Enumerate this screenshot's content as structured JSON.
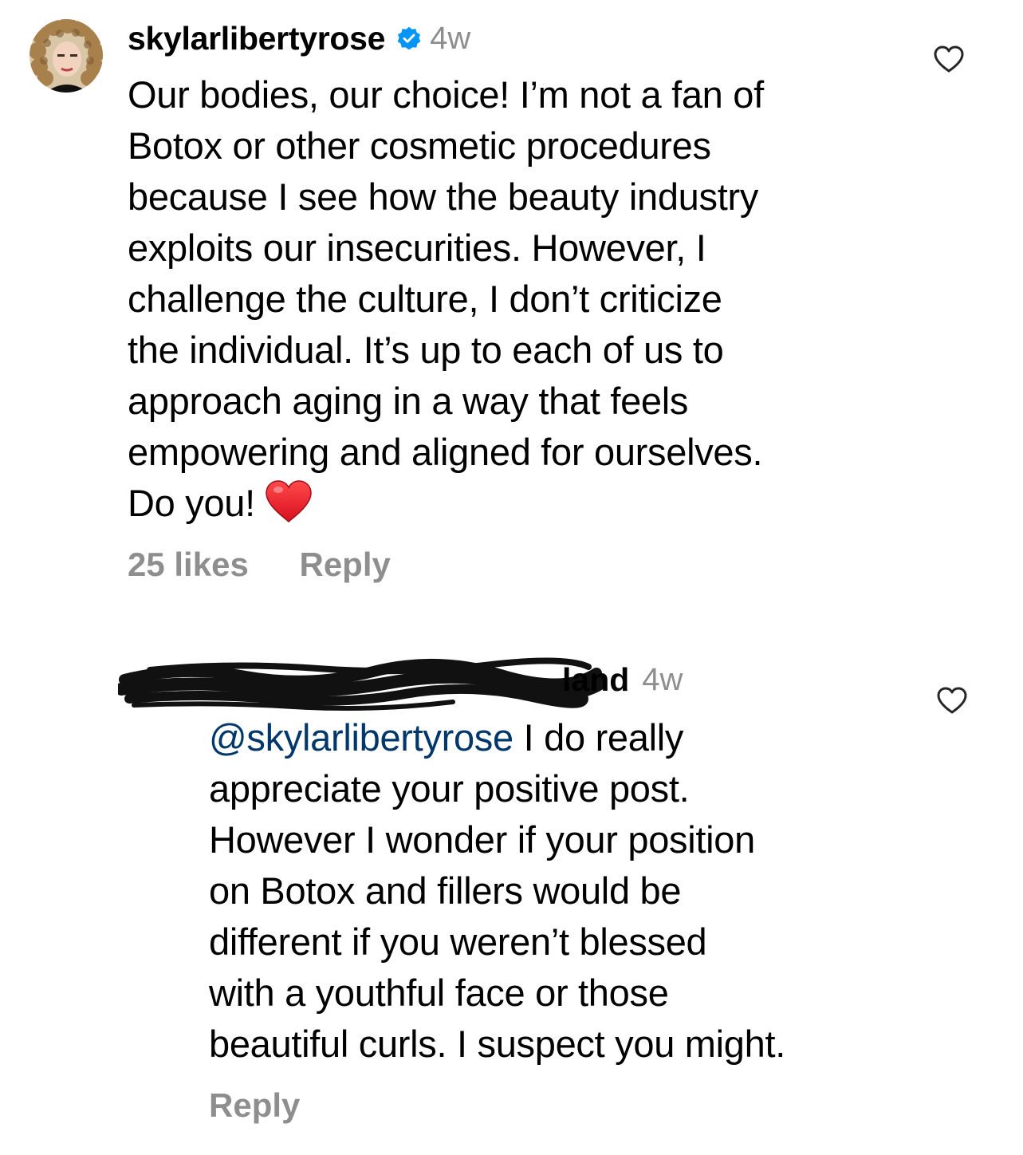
{
  "comments": [
    {
      "username": "skylarlibertyrose",
      "verified": true,
      "time": "4w",
      "avatar": "curly-hair-avatar",
      "text_lines": [
        "Our bodies, our choice! I’m not a fan of",
        "Botox or other cosmetic procedures",
        "because I see how the beauty industry",
        "exploits our insecurities. However, I",
        "challenge the culture, I don’t criticize",
        "the individual. It’s up to each of us to",
        "approach aging in a way that feels",
        "empowering and aligned for ourselves.",
        "Do you!"
      ],
      "emoji": "red-heart",
      "likes": "25 likes",
      "reply_label": "Reply",
      "like_icon": "heart-outline-icon"
    },
    {
      "username_visible": "land",
      "username_redacted": true,
      "time": "4w",
      "mention": "@skylarlibertyrose",
      "text_lines": [
        " I do really",
        "appreciate your positive post.",
        "However I wonder if your position",
        "on Botox and fillers would be",
        "different if you weren’t blessed",
        "with a youthful face or those",
        "beautiful curls. I suspect you might."
      ],
      "reply_label": "Reply",
      "like_icon": "heart-outline-icon"
    }
  ],
  "colors": {
    "text": "#000000",
    "secondary": "#8e8e8e",
    "mention": "#00376b",
    "verified": "#0095f6",
    "heart": "#e0245e"
  }
}
